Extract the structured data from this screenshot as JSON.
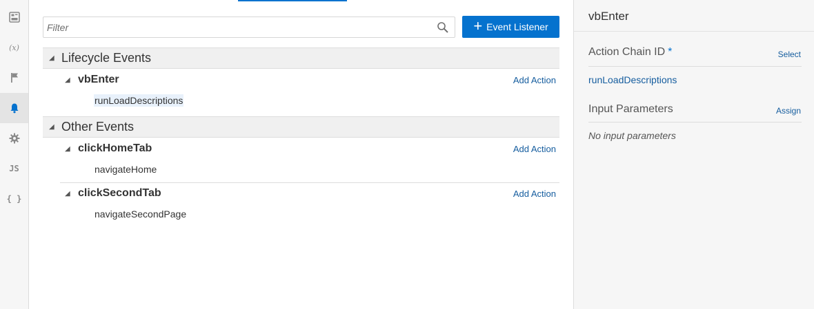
{
  "rail": {
    "items": [
      {
        "icon": "dashboard-icon"
      },
      {
        "icon": "variables-icon",
        "text": "(x)"
      },
      {
        "icon": "flag-icon"
      },
      {
        "icon": "bell-icon",
        "active": true
      },
      {
        "icon": "gear-icon"
      },
      {
        "icon": "javascript-icon",
        "text": "JS"
      },
      {
        "icon": "json-icon",
        "text": "{ }"
      }
    ]
  },
  "filter": {
    "placeholder": "Filter"
  },
  "toolbar": {
    "event_listener_label": "Event Listener",
    "plus": "+"
  },
  "sections": {
    "lifecycle": {
      "label": "Lifecycle Events",
      "events": [
        {
          "name": "vbEnter",
          "add_action": "Add Action",
          "chain": "runLoadDescriptions"
        }
      ]
    },
    "other": {
      "label": "Other Events",
      "events": [
        {
          "name": "clickHomeTab",
          "add_action": "Add Action",
          "chain": "navigateHome"
        },
        {
          "name": "clickSecondTab",
          "add_action": "Add Action",
          "chain": "navigateSecondPage"
        }
      ]
    }
  },
  "properties": {
    "title": "vbEnter",
    "action_chain_label": "Action Chain ID",
    "required_marker": "*",
    "select_label": "Select",
    "action_chain_value": "runLoadDescriptions",
    "input_params_label": "Input Parameters",
    "assign_label": "Assign",
    "no_params_text": "No input parameters"
  },
  "colors": {
    "accent": "#0572ce",
    "link": "#145c9e",
    "selected_bg": "#e8f1fb"
  }
}
